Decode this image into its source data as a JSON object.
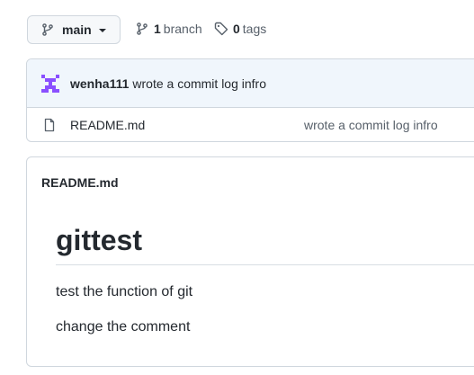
{
  "toolbar": {
    "branch_name": "main",
    "branches_count": "1",
    "branches_label": "branch",
    "tags_count": "0",
    "tags_label": "tags"
  },
  "latest_commit": {
    "author": "wenha111",
    "message": "wrote a commit log infro"
  },
  "files": [
    {
      "name": "README.md",
      "commit_message": "wrote a commit log infro",
      "icon": "file-icon"
    }
  ],
  "readme": {
    "title": "README.md",
    "heading": "gittest",
    "paragraphs": [
      "test the function of git",
      "change the comment"
    ]
  },
  "colors": {
    "border": "#d0d7de",
    "commit_header_bg": "#f0f6fc",
    "muted_text": "#57606a",
    "avatar": "#8a4fff"
  }
}
